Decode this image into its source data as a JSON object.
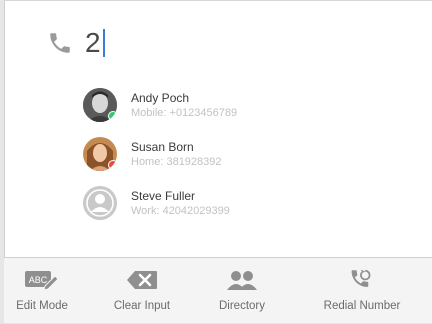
{
  "dial": {
    "typed_number": "2"
  },
  "contacts": [
    {
      "name": "Andy Poch",
      "detail": "Mobile: +0123456789",
      "status_color": "#2ecc71"
    },
    {
      "name": "Susan Born",
      "detail": "Home: 381928392",
      "status_color": "#e74c3c"
    },
    {
      "name": "Steve Fuller",
      "detail": "Work: 42042029399"
    }
  ],
  "toolbar": {
    "edit_mode_label": "Edit Mode",
    "edit_mode_icon_text": "ABC",
    "clear_input_label": "Clear Input",
    "directory_label": "Directory",
    "redial_label": "Redial Number"
  },
  "colors": {
    "icon_gray": "#8f8f8f",
    "caret": "#3a7bd5",
    "available": "#2ecc71",
    "busy": "#e74c3c"
  }
}
